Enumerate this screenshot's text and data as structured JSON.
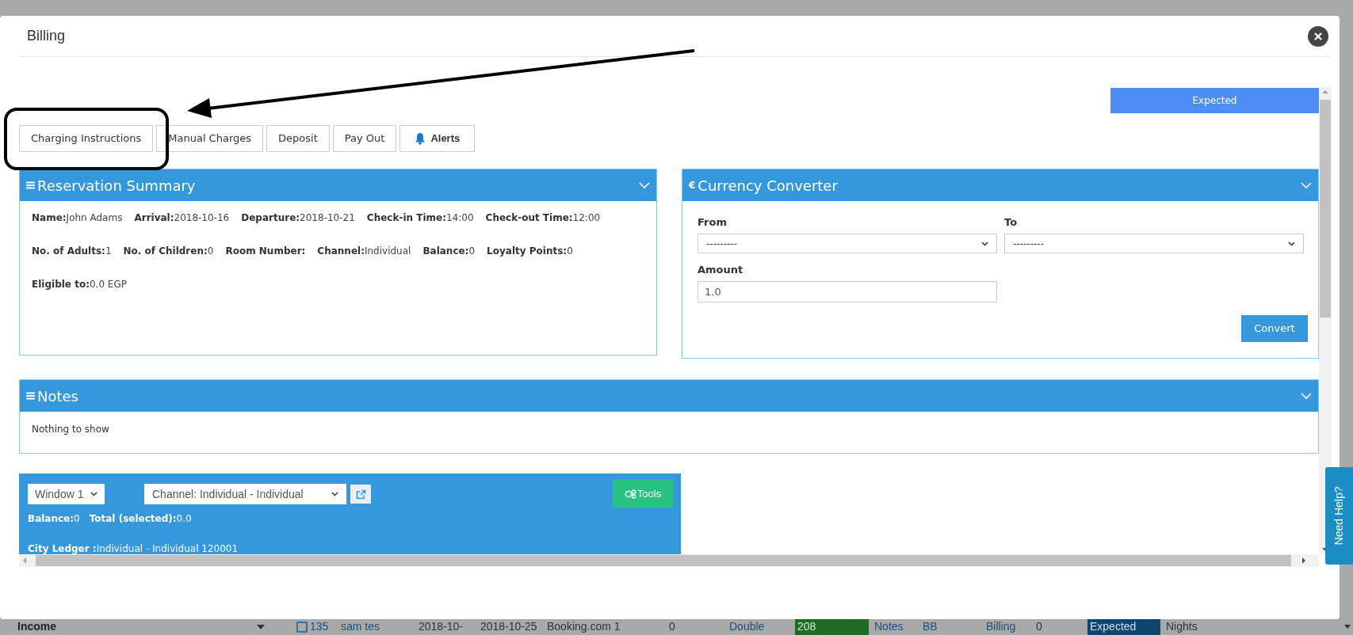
{
  "modal": {
    "title": "Billing"
  },
  "status_bar": {
    "label": "Expected"
  },
  "action_buttons": [
    {
      "label": "Charging Instructions",
      "kind": "plain"
    },
    {
      "label": "Manual Charges",
      "kind": "plain"
    },
    {
      "label": "Deposit",
      "kind": "plain"
    },
    {
      "label": "Pay Out",
      "kind": "plain"
    },
    {
      "label": "Alerts",
      "kind": "alert"
    }
  ],
  "reservation_summary": {
    "title": "Reservation Summary",
    "fields": [
      {
        "label": "Name:",
        "value": "John Adams"
      },
      {
        "label": "Arrival:",
        "value": "2018-10-16"
      },
      {
        "label": "Departure:",
        "value": "2018-10-21"
      },
      {
        "label": "Check-in Time:",
        "value": "14:00"
      },
      {
        "label": "Check-out Time:",
        "value": "12:00"
      },
      {
        "label": "No. of Adults:",
        "value": "1"
      },
      {
        "label": "No. of Children:",
        "value": "0"
      },
      {
        "label": "Room Number:"
      },
      {
        "label": "Channel:",
        "value": "Individual"
      },
      {
        "label": "Balance:",
        "value": "0"
      },
      {
        "label": "Loyalty Points:",
        "value": "0"
      },
      {
        "label": "Eligible to:",
        "value": "0.0 EGP"
      }
    ]
  },
  "currency_converter": {
    "icon": "€",
    "title": "Currency Converter",
    "from_label": "From",
    "from_value": "---------",
    "to_label": "To",
    "to_value": "---------",
    "amount_label": "Amount",
    "amount_value": "1.0",
    "convert_button": "Convert"
  },
  "notes": {
    "title": "Notes",
    "empty_text": "Nothing to show"
  },
  "folio": {
    "window_select": "Window 1",
    "channel_select": "Channel: Individual - Individual",
    "tools_button": "Tools",
    "totals": [
      {
        "label": "Balance:",
        "value": "0"
      },
      {
        "label": "Total (selected):",
        "value": "0.0"
      }
    ],
    "city_ledger": {
      "label": "City Ledger :",
      "value": "Individual - Individual 120001"
    }
  },
  "help_tab": {
    "label": "Need Help?"
  },
  "background_row": {
    "filter": "Income",
    "checkbox": {
      "checked": false
    },
    "cells": [
      {
        "text": "135",
        "kind": "link"
      },
      {
        "text": "sam tes",
        "kind": "link"
      },
      {
        "text": "2018-10-",
        "kind": "text"
      },
      {
        "text": "2018-10-25",
        "kind": "text"
      },
      {
        "text": "Booking.com 1",
        "kind": "text"
      },
      {
        "text": "0",
        "kind": "text"
      },
      {
        "text": "Double",
        "kind": "link"
      },
      {
        "text": "208",
        "kind": "room"
      },
      {
        "text": "Notes",
        "kind": "link"
      },
      {
        "text": "BB",
        "kind": "link"
      },
      {
        "text": "Billing",
        "kind": "link"
      },
      {
        "text": "0",
        "kind": "text"
      },
      {
        "text": "Expected",
        "kind": "status"
      },
      {
        "text": "Nights",
        "kind": "text"
      }
    ]
  }
}
